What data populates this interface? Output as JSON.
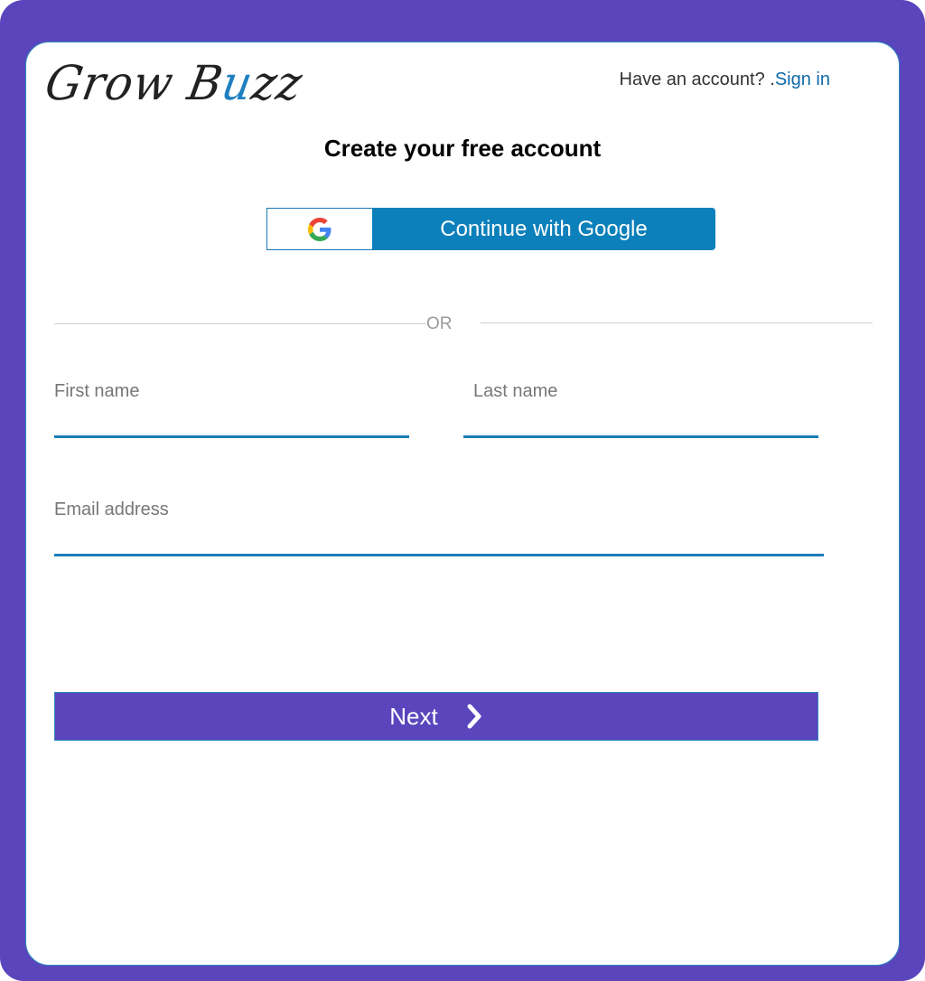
{
  "brand": {
    "logo_part1": "Grow B",
    "logo_part2": "u",
    "logo_part3": "zz",
    "accent_color": "#1f7fc0"
  },
  "header": {
    "have_account_text": "Have an account? .",
    "signin_label": "Sign in"
  },
  "form": {
    "title": "Create your free account",
    "google_button_label": "Continue with Google",
    "divider_text": "OR",
    "first_name": {
      "label": "First name",
      "value": ""
    },
    "last_name": {
      "label": "Last name",
      "value": ""
    },
    "email": {
      "label": "Email address",
      "value": ""
    },
    "next_label": "Next"
  },
  "colors": {
    "frame": "#5a45bd",
    "google_button": "#0c80bb",
    "next_button": "#5a45bd",
    "link": "#0f6aa8"
  }
}
